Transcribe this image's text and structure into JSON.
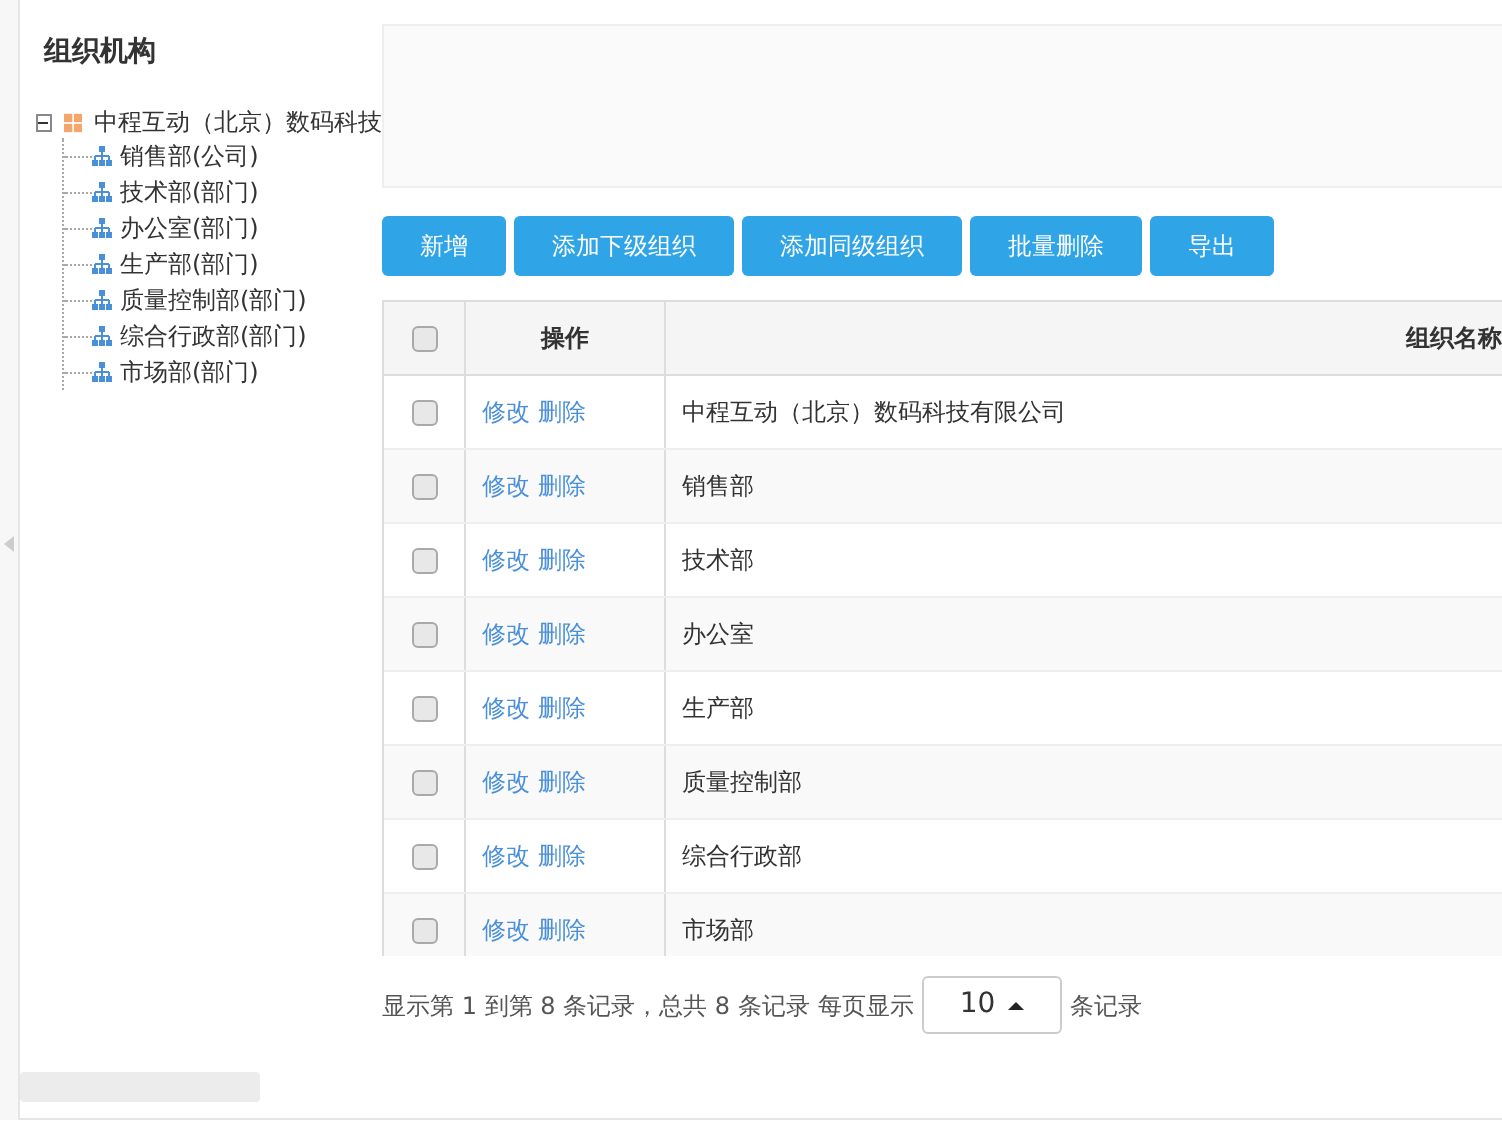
{
  "sidebar": {
    "title": "组织机构",
    "tree": {
      "label": "中程互动（北京）数码科技",
      "expanded": true,
      "children": [
        {
          "label": "销售部(公司)"
        },
        {
          "label": "技术部(部门)"
        },
        {
          "label": "办公室(部门)"
        },
        {
          "label": "生产部(部门)"
        },
        {
          "label": "质量控制部(部门)"
        },
        {
          "label": "综合行政部(部门)"
        },
        {
          "label": "市场部(部门)"
        }
      ]
    }
  },
  "toolbar": [
    "新增",
    "添加下级组织",
    "添加同级组织",
    "批量删除",
    "导出"
  ],
  "table": {
    "columns": [
      "操作",
      "组织名称"
    ],
    "header_checked": false,
    "rows": [
      {
        "checked": false,
        "actions": [
          "修改",
          "删除"
        ],
        "name": "中程互动（北京）数码科技有限公司"
      },
      {
        "checked": false,
        "actions": [
          "修改",
          "删除"
        ],
        "name": "销售部"
      },
      {
        "checked": false,
        "actions": [
          "修改",
          "删除"
        ],
        "name": "技术部"
      },
      {
        "checked": false,
        "actions": [
          "修改",
          "删除"
        ],
        "name": "办公室"
      },
      {
        "checked": false,
        "actions": [
          "修改",
          "删除"
        ],
        "name": "生产部"
      },
      {
        "checked": false,
        "actions": [
          "修改",
          "删除"
        ],
        "name": "质量控制部"
      },
      {
        "checked": false,
        "actions": [
          "修改",
          "删除"
        ],
        "name": "综合行政部"
      },
      {
        "checked": false,
        "actions": [
          "修改",
          "删除"
        ],
        "name": "市场部"
      }
    ]
  },
  "pagination": {
    "summary": "显示第 1 到第 8 条记录，总共 8 条记录",
    "per_page_label": "每页显示",
    "page_size": "10",
    "suffix": "条记录"
  }
}
